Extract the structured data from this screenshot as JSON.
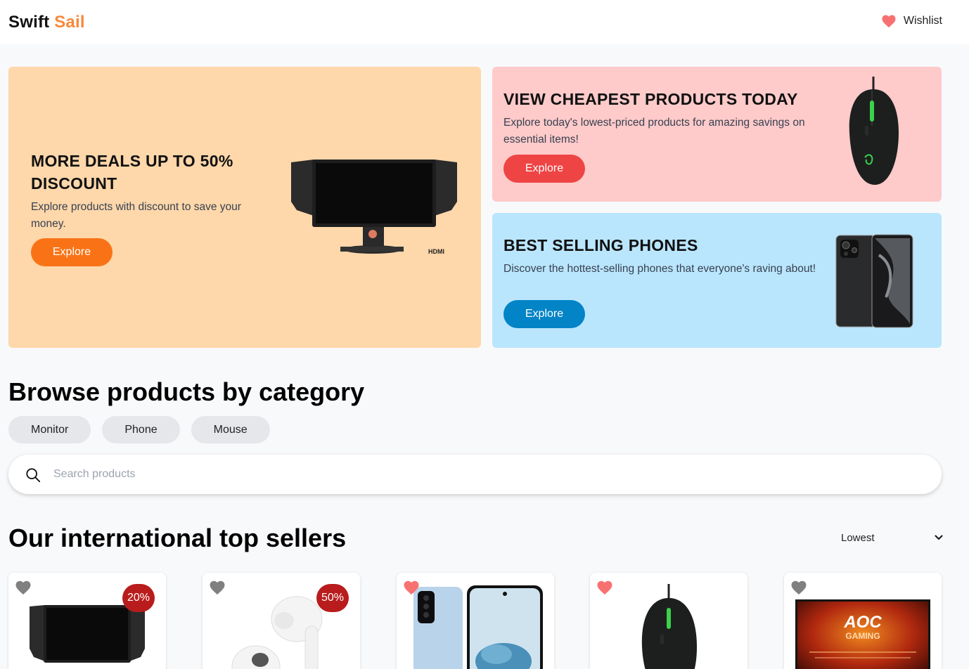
{
  "header": {
    "brand_part1": "Swift",
    "brand_part2": "Sail",
    "wishlist_label": "Wishlist",
    "brand_accent_color": "#f7893b",
    "heart_color": "#f87171"
  },
  "banners": [
    {
      "title": "MORE DEALS UP TO 50% DISCOUNT",
      "description": "Explore products with discount to save your money.",
      "button": "Explore",
      "bg_color": "#fed7aa",
      "button_color": "#f97316",
      "image": "monitor"
    },
    {
      "title": "VIEW CHEAPEST PRODUCTS TODAY",
      "description": "Explore today's lowest-priced products for amazing savings on essential items!",
      "button": "Explore",
      "bg_color": "#fecaca",
      "button_color": "#ef4444",
      "image": "gaming-mouse"
    },
    {
      "title": "BEST SELLING PHONES",
      "description": "Discover the hottest-selling phones that everyone's raving about!",
      "button": "Explore",
      "bg_color": "#bae6fd",
      "button_color": "#0284c7",
      "image": "phone"
    }
  ],
  "categories": {
    "heading": "Browse products by category",
    "items": [
      "Monitor",
      "Phone",
      "Mouse"
    ]
  },
  "search": {
    "placeholder": "Search products",
    "value": ""
  },
  "top_sellers": {
    "heading": "Our international top sellers",
    "sort_selected": "Lowest",
    "products": [
      {
        "image": "monitor",
        "discount": "20%",
        "wishlisted": false
      },
      {
        "image": "earbuds",
        "discount": "50%",
        "wishlisted": false
      },
      {
        "image": "phone",
        "discount": "",
        "wishlisted": true
      },
      {
        "image": "gaming-mouse",
        "discount": "",
        "wishlisted": true
      },
      {
        "image": "aoc-gaming-monitor",
        "discount": "",
        "wishlisted": false,
        "image_text": [
          "AOC",
          "GAMING"
        ]
      }
    ]
  }
}
